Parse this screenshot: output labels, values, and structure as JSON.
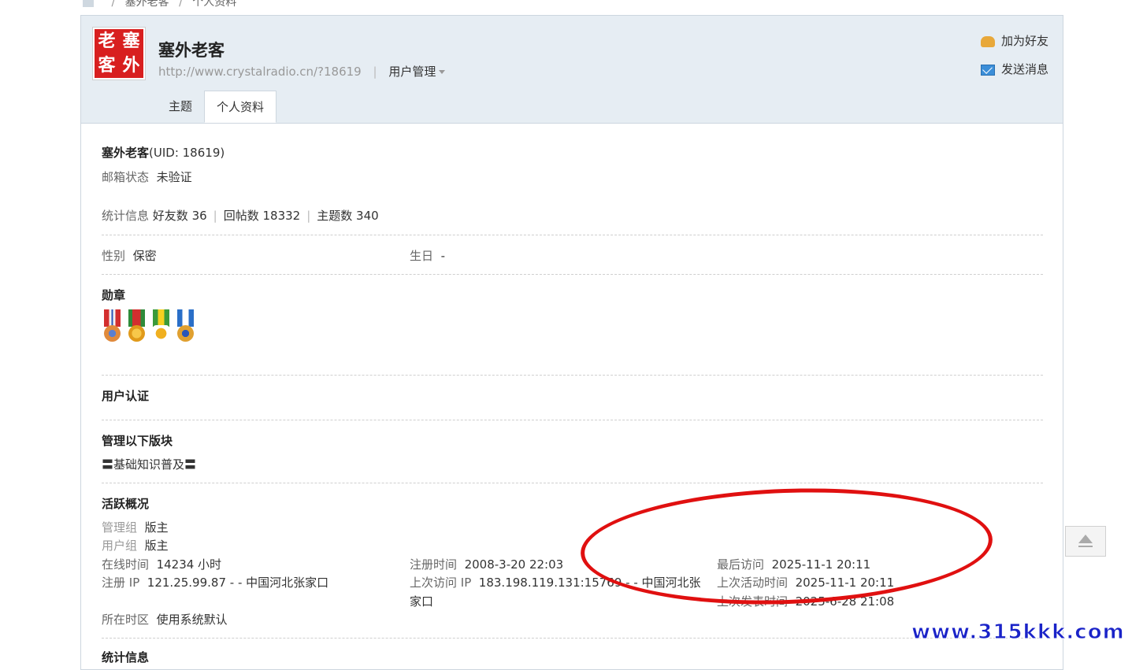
{
  "breadcrumb": {
    "sep1": "/",
    "item1": "塞外老客",
    "sep2": "/",
    "item2": "个人资料"
  },
  "header": {
    "username": "塞外老客",
    "avatar_chars": [
      "老",
      "塞",
      "客",
      "外"
    ],
    "url": "http://www.crystalradio.cn/?18619",
    "pipe": "|",
    "user_manage": "用户管理",
    "add_friend": "加为好友",
    "send_message": "发送消息"
  },
  "tabs": [
    {
      "label": "主题"
    },
    {
      "label": "个人资料"
    }
  ],
  "profile": {
    "name": "塞外老客",
    "uid": "(UID: 18619)",
    "email_label": "邮箱状态",
    "email_value": "未验证",
    "stats_label": "统计信息",
    "friends": "好友数 36",
    "posts": "回帖数 18332",
    "threads": "主题数 340",
    "gender_label": "性别",
    "gender_value": "保密",
    "birthday_label": "生日",
    "birthday_value": "-",
    "medals_title": "勋章",
    "verify_title": "用户认证",
    "manage_title": "管理以下版块",
    "manage_forum": "〓基础知识普及〓",
    "activity_title": "活跃概况",
    "admin_group_label": "管理组",
    "admin_group_value": "版主",
    "user_group_label": "用户组",
    "user_group_value": "版主",
    "online_label": "在线时间",
    "online_value": "14234 小时",
    "reg_time_label": "注册时间",
    "reg_time_value": "2008-3-20 22:03",
    "last_visit_label": "最后访问",
    "last_visit_value": "2025-11-1 20:11",
    "reg_ip_label": "注册 IP",
    "reg_ip_value": "121.25.99.87 - - 中国河北张家口",
    "last_ip_label": "上次访问 IP",
    "last_ip_value": "183.198.119.131:15769 - - 中国河北张",
    "last_ip_value2": "家口",
    "last_active_label": "上次活动时间",
    "last_active_value": "2025-11-1 20:11",
    "last_post_label": "上次发表时间",
    "last_post_value": "2025-6-28 21:08",
    "timezone_label": "所在时区",
    "timezone_value": "使用系统默认",
    "stats_title2": "统计信息"
  },
  "medals": [
    {
      "name": "medal-1",
      "ribbon": "#d32f2f",
      "disc": "#e08a3c"
    },
    {
      "name": "medal-2",
      "ribbon": "#2e8b3a",
      "disc": "#f0a020"
    },
    {
      "name": "medal-3",
      "ribbon": "#3a9a3a",
      "disc": "#f0b020"
    },
    {
      "name": "medal-4",
      "ribbon": "#2a6fc8",
      "disc": "#e0a030"
    }
  ],
  "watermark": "www.315kkk.com",
  "colors": {
    "header_bg": "#e6edf3",
    "annotation_red": "#e01010",
    "watermark_blue": "#1a23c8"
  }
}
